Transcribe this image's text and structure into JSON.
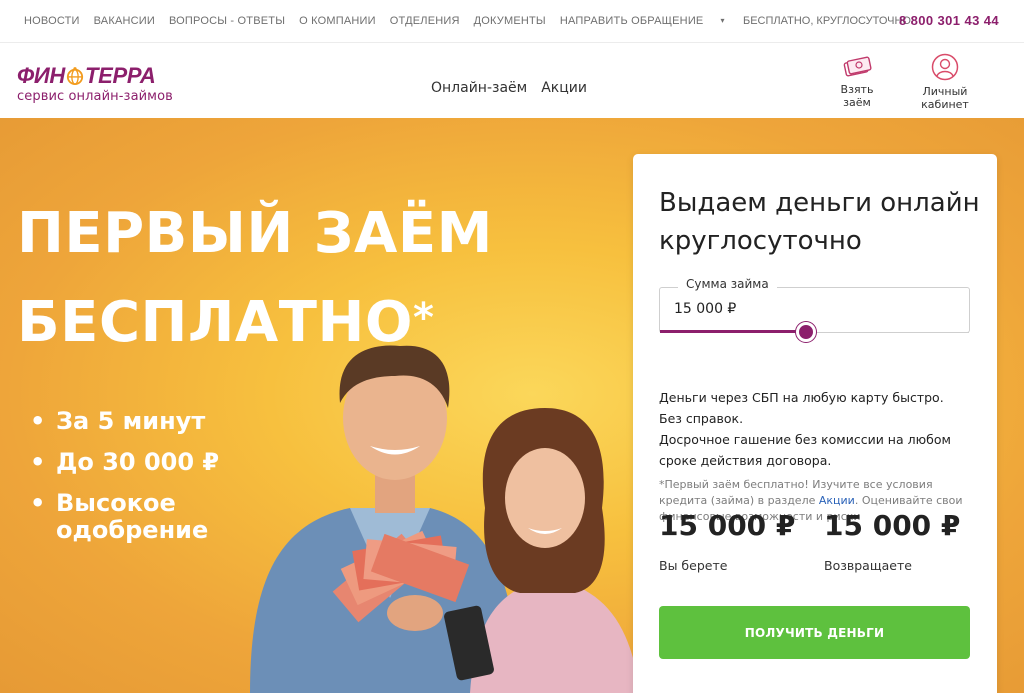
{
  "topbar": {
    "nav": [
      "НОВОСТИ",
      "ВАКАНСИИ",
      "ВОПРОСЫ - ОТВЕТЫ",
      "О КОМПАНИИ",
      "ОТДЕЛЕНИЯ",
      "ДОКУМЕНТЫ"
    ],
    "appeal": "НАПРАВИТЬ ОБРАЩЕНИЕ",
    "free_text": "БЕСПЛАТНО, КРУГЛОСУТОЧНО",
    "phone": "8 800 301 43 44"
  },
  "header": {
    "logo_left": "ФИН",
    "logo_right": "ТЕРРА",
    "logo_sub": "сервис онлайн-займов",
    "nav": [
      "Онлайн-заём",
      "Акции"
    ],
    "take_loan": "Взять заём",
    "cabinet": "Личный кабинет"
  },
  "hero": {
    "title_line1": "ПЕРВЫЙ ЗАЁМ",
    "title_line2": "БЕСПЛАТНО",
    "title_mark": "*",
    "bullets": [
      "За 5 минут",
      "До 30 000 ₽",
      "Высокое одобрение"
    ]
  },
  "form": {
    "title": "Выдаем деньги онлайн круглосуточно",
    "field_label": "Сумма займа",
    "field_value": "15 000 ₽",
    "slider_fraction": 0.47,
    "info_line1": "Деньги через СБП на любую карту быстро. Без справок.",
    "info_line2": "Досрочное гашение без комиссии на любом сроке действия договора.",
    "note_before": "*Первый заём бесплатно! Изучите все условия кредита (займа) в разделе ",
    "note_link": "Акции",
    "note_after": ". Оценивайте свои финансовые возможности и риски",
    "take_amount": "15 000 ₽",
    "take_label": "Вы берете",
    "return_amount": "15 000 ₽",
    "return_label": "Возвращаете",
    "cta": "ПОЛУЧИТЬ ДЕНЬГИ"
  },
  "colors": {
    "brand": "#8c1f6c",
    "accent_orange": "#f29c1e",
    "cta_green": "#5ec13e",
    "hero_bg": "#f7c03e"
  }
}
